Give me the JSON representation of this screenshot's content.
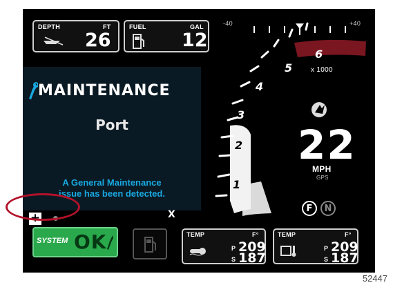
{
  "depth": {
    "label": "DEPTH",
    "unit": "FT",
    "value": "26"
  },
  "fuel": {
    "label": "FUEL",
    "unit": "GAL",
    "value": "12"
  },
  "trim": {
    "low": "-40",
    "high": "+40"
  },
  "tach": {
    "ticks": [
      "1",
      "2",
      "3",
      "4",
      "5",
      "6"
    ],
    "unit": "x 1000"
  },
  "speed": {
    "value": "22",
    "unit": "MPH",
    "source": "GPS"
  },
  "gear": {
    "forward": "F",
    "neutral": "N"
  },
  "popup": {
    "title": "MAINTENANCE",
    "subtitle": "Port",
    "message_line1": "A General Maintenance",
    "message_line2": "issue has been detected.",
    "close": "X",
    "expand": "+"
  },
  "system": {
    "label": "SYSTEM",
    "status": "OK"
  },
  "temp_water": {
    "label": "TEMP",
    "unit": "F°",
    "port_label": "P",
    "port_value": "209",
    "starboard_label": "S",
    "starboard_value": "187"
  },
  "temp_engine": {
    "label": "TEMP",
    "unit": "F°",
    "port_label": "P",
    "port_value": "209",
    "starboard_label": "S",
    "starboard_value": "187"
  },
  "figure_number": "52447",
  "colors": {
    "accent_blue": "#19a8e0",
    "ok_green": "#2aa94c",
    "red_zone": "#8b1a22",
    "callout_red": "#b3122a"
  }
}
